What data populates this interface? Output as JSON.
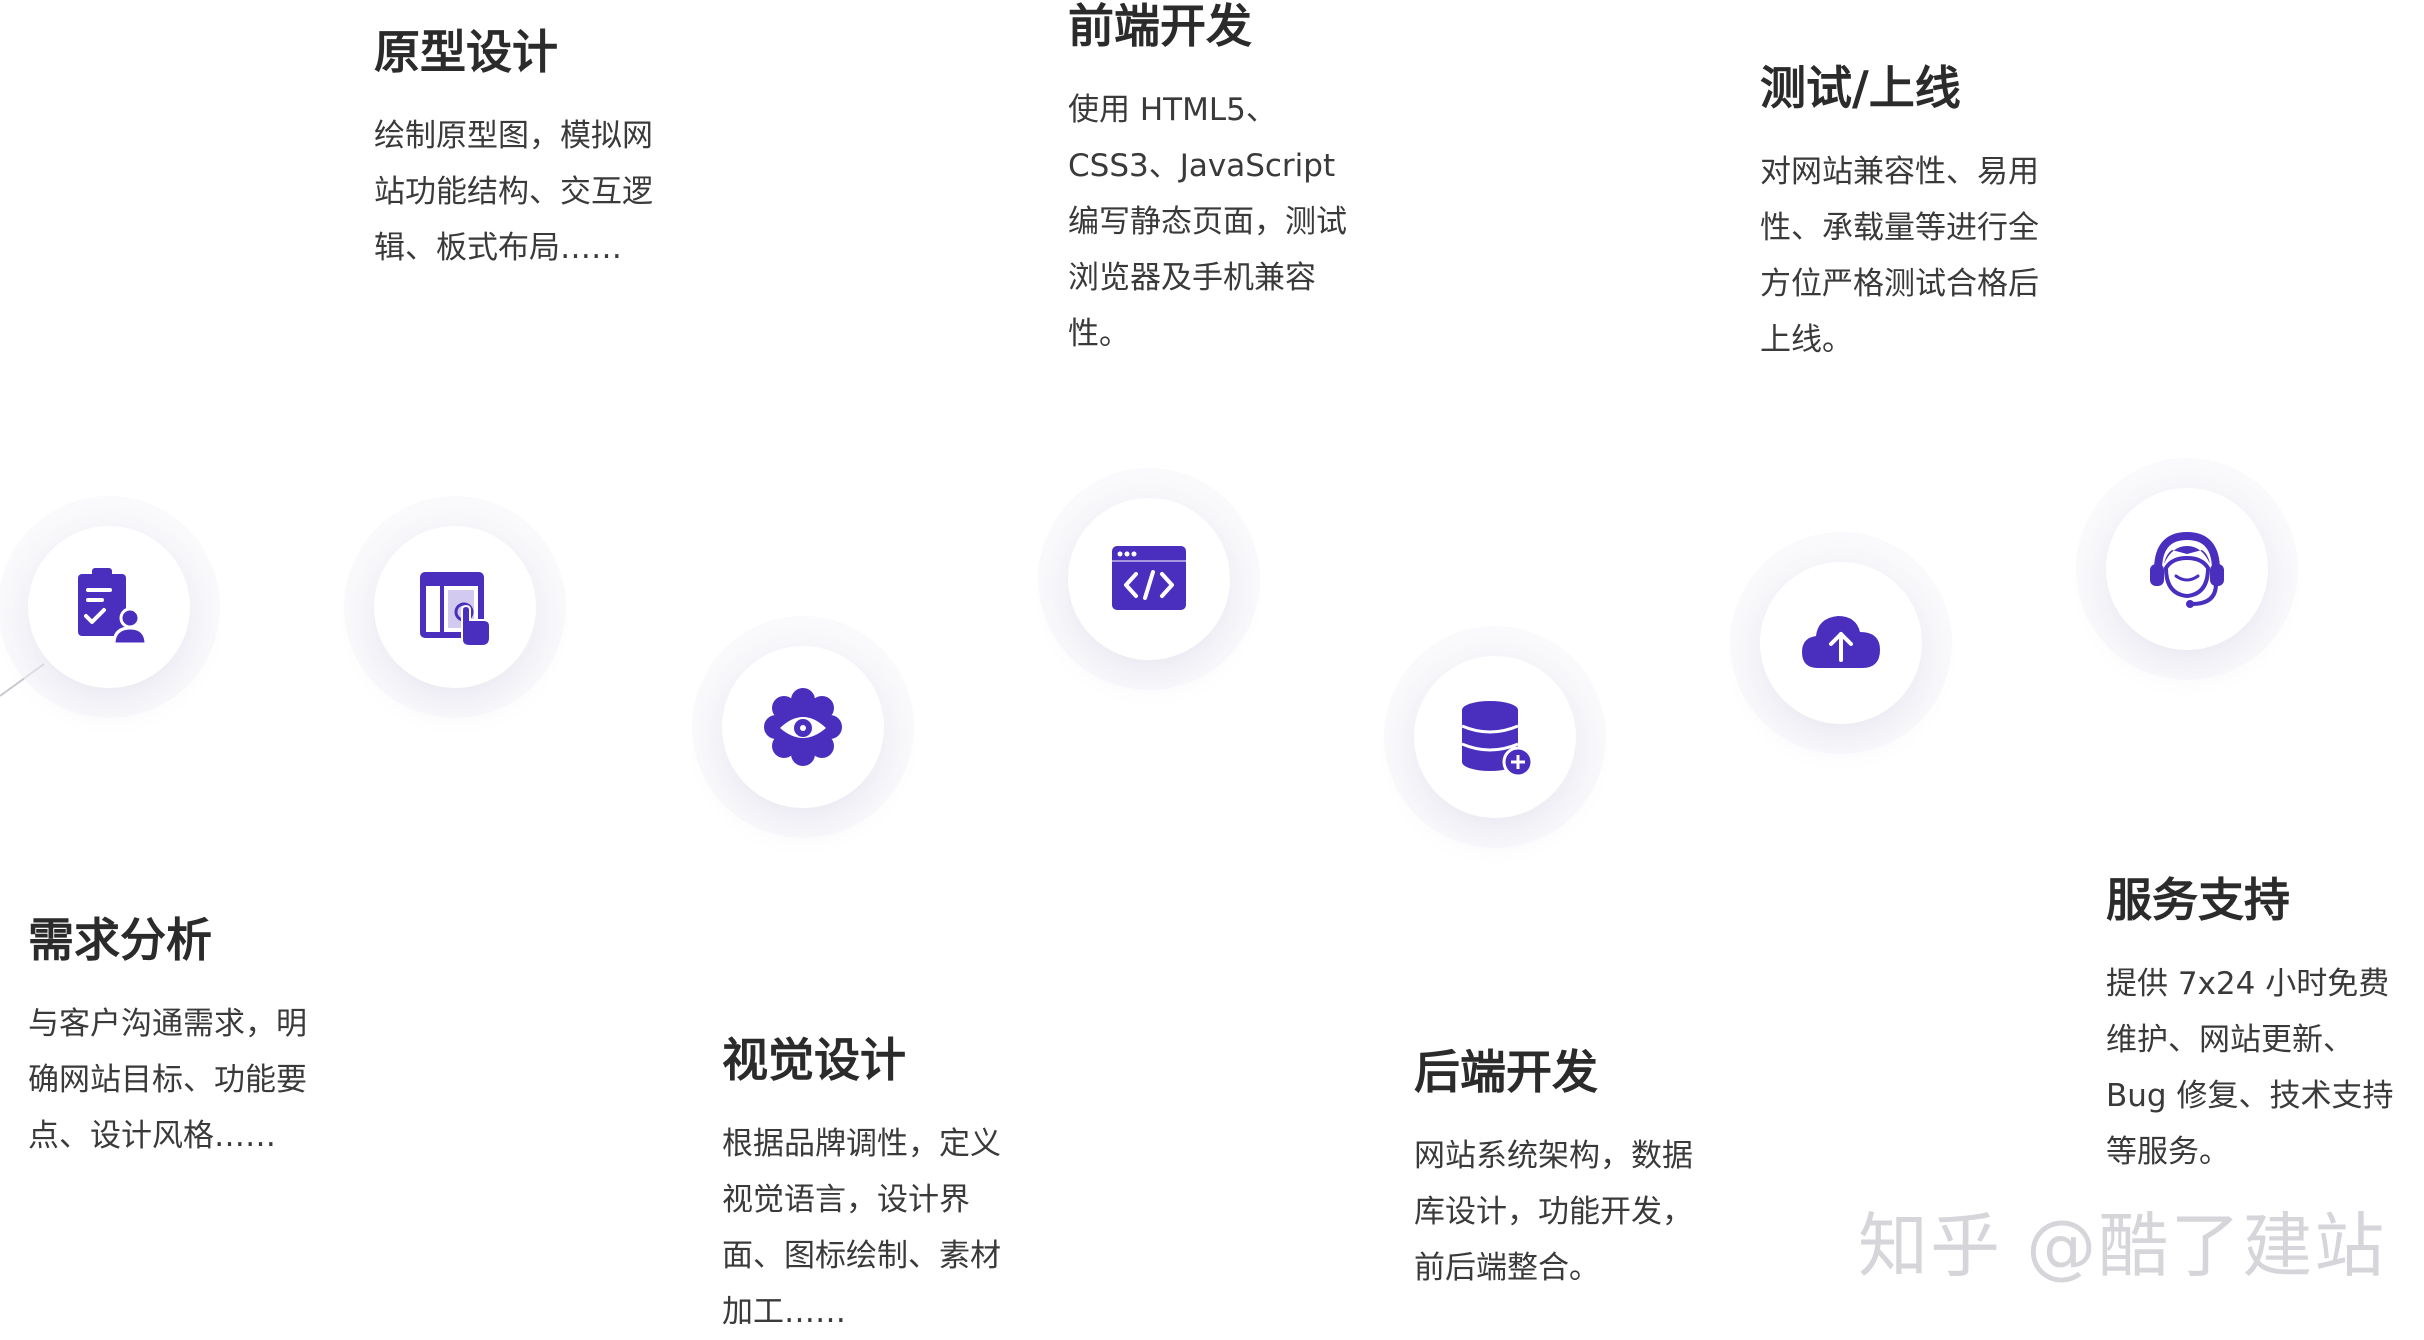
{
  "colors": {
    "accent": "#4a2fbf",
    "heading": "#2b2b2b",
    "text": "#3a3a3a"
  },
  "steps": [
    {
      "title": "需求分析",
      "desc": "与客户沟通需求，明\n确网站目标、功能要\n点、设计风格……",
      "icon": "clipboard-user-icon"
    },
    {
      "title": "原型设计",
      "desc": "绘制原型图，模拟网\n站功能结构、交互逻\n辑、板式布局……",
      "icon": "layout-pointer-icon"
    },
    {
      "title": "视觉设计",
      "desc": "根据品牌调性，定义\n视觉语言，设计界\n面、图标绘制、素材\n加工……",
      "icon": "eye-flower-icon"
    },
    {
      "title": "前端开发",
      "desc": "使用 HTML5、\nCSS3、JavaScript\n编写静态页面，测试\n浏览器及手机兼容\n性。",
      "icon": "code-window-icon"
    },
    {
      "title": "后端开发",
      "desc": "网站系统架构，数据\n库设计，功能开发，\n前后端整合。",
      "icon": "database-add-icon"
    },
    {
      "title": "测试/上线",
      "desc": "对网站兼容性、易用\n性、承载量等进行全\n方位严格测试合格后\n上线。",
      "icon": "cloud-upload-icon"
    },
    {
      "title": "服务支持",
      "desc": "提供 7x24 小时免费\n维护、网站更新、\nBug 修复、技术支持\n等服务。",
      "icon": "headset-support-icon"
    }
  ],
  "watermark": "知乎 @酷了建站"
}
